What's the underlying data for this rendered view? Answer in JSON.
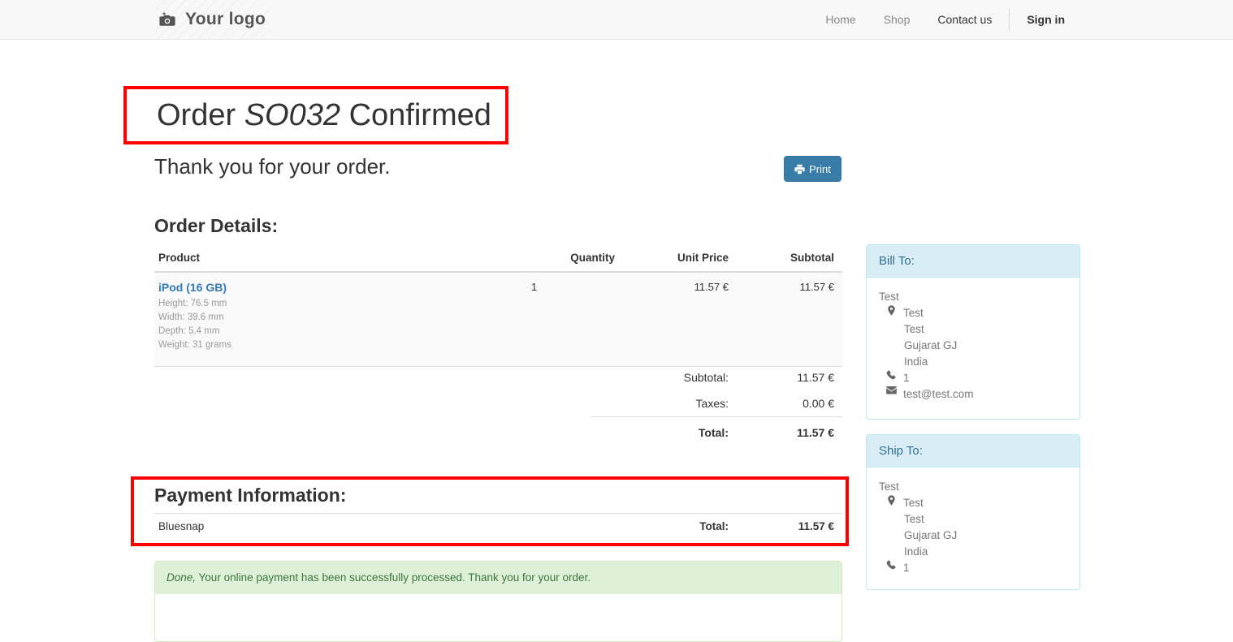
{
  "header": {
    "logo_text": "Your logo",
    "logo_icon": "camera-icon",
    "nav": [
      {
        "label": "Home",
        "active": false
      },
      {
        "label": "Shop",
        "active": false
      },
      {
        "label": "Contact us",
        "active": true
      }
    ],
    "sign_in_label": "Sign in"
  },
  "main": {
    "title_prefix": "Order ",
    "order_ref": "SO032",
    "title_suffix": " Confirmed",
    "thank_you": "Thank you for your order.",
    "print_label": "Print",
    "print_icon": "printer-icon",
    "order_details_heading": "Order Details:",
    "payment_heading": "Payment Information:"
  },
  "order_table": {
    "columns": [
      "Product",
      "Quantity",
      "Unit Price",
      "Subtotal"
    ],
    "rows": [
      {
        "product": "iPod (16 GB)",
        "attributes": [
          "Height: 76.5 mm",
          "Width: 39.6 mm",
          "Depth: 5.4 mm",
          "Weight: 31 grams"
        ],
        "quantity": "1",
        "unit_price": "11.57 €",
        "subtotal": "11.57 €"
      }
    ]
  },
  "totals": {
    "subtotal_label": "Subtotal:",
    "subtotal_value": "11.57 €",
    "taxes_label": "Taxes:",
    "taxes_value": "0.00 €",
    "total_label": "Total:",
    "total_value": "11.57 €"
  },
  "payment": {
    "acquirer": "Bluesnap",
    "total_label": "Total:",
    "total_value": "11.57 €"
  },
  "alert": {
    "status_word": "Done,",
    "message": " Your online payment has been successfully processed. Thank you for your order."
  },
  "bill_to": {
    "heading": "Bill To:",
    "name": "Test",
    "address_icon": "map-pin-icon",
    "address_line1": "Test",
    "address_line2": "Test",
    "address_line3": "Gujarat GJ",
    "address_line4": "India",
    "phone_icon": "phone-icon",
    "phone": "1",
    "email_icon": "envelope-icon",
    "email": "test@test.com"
  },
  "ship_to": {
    "heading": "Ship To:",
    "name": "Test",
    "address_icon": "map-pin-icon",
    "address_line1": "Test",
    "address_line2": "Test",
    "address_line3": "Gujarat GJ",
    "address_line4": "India",
    "phone_icon": "phone-icon",
    "phone": "1"
  },
  "annotations": {
    "highlight_color": "#fe0000",
    "boxes": [
      "order-title",
      "payment-information"
    ]
  },
  "colors": {
    "accent_blue": "#337ab7",
    "print_button": "#3a7ca8",
    "panel_header_bg": "#d9edf7",
    "panel_header_text": "#31708f",
    "alert_bg": "#dff0d8",
    "alert_text": "#3c763d",
    "link": "#337ab7"
  }
}
